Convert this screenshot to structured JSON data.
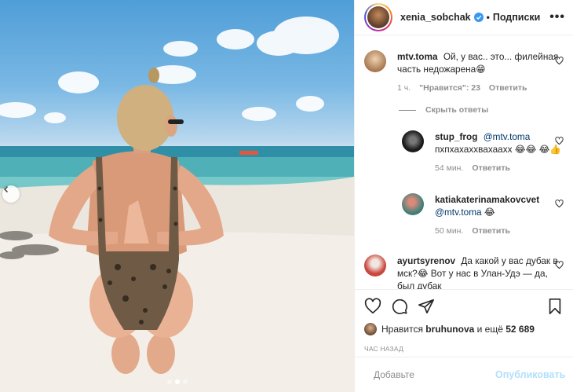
{
  "header": {
    "username": "xenia_sobchak",
    "separator": "•",
    "follow_label": "Подписки",
    "more_label": "•••"
  },
  "comments": [
    {
      "user": "mtv.toma",
      "text": "Ой, у вас.. это... филейная часть недожарена😁",
      "time": "1 ч.",
      "likes": "\"Нравится\": 23",
      "reply_label": "Ответить",
      "avatar_color": "#d9b38c"
    },
    {
      "user": "ayurtsyrenov",
      "text": "Да какой у вас дубак в мск?😂 Вот у нас в Улан-Удэ — да, был дубак",
      "avatar_color": "#c9473f"
    }
  ],
  "hide_replies_label": "Скрыть ответы",
  "replies": [
    {
      "user": "stup_frog",
      "mention": "@mtv.toma",
      "text": "пхпхахаххвахааxx 😂😂 😂👍",
      "time": "54 мин.",
      "reply_label": "Ответить",
      "avatar_color": "#1a1a1a"
    },
    {
      "user": "katiakaterinamakovcvet",
      "mention": "@mtv.toma",
      "text": "😂",
      "time": "50 мин.",
      "reply_label": "Ответить",
      "avatar_color": "#4a8f8a"
    }
  ],
  "likes": {
    "prefix": "Нравится",
    "user": "bruhunova",
    "middle": "и ещё",
    "count": "52 689"
  },
  "time_ago": "ЧАС НАЗАД",
  "add_comment": {
    "placeholder": "Добавьте",
    "publish_label": "Опубликовать"
  },
  "colors": {
    "accent": "#0095f6",
    "publish_disabled": "#b2dffc",
    "verified": "#3897f0",
    "text": "#262626",
    "muted": "#8e8e8e"
  },
  "carousel": {
    "total": 3,
    "active": 2
  }
}
